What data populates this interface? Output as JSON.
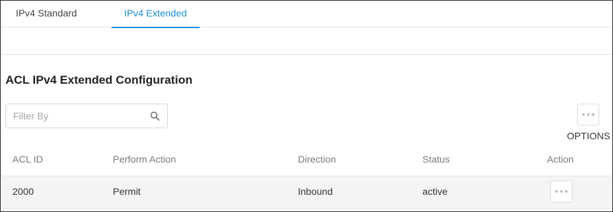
{
  "tabs": [
    {
      "label": "IPv4 Standard",
      "active": false
    },
    {
      "label": "IPv4 Extended",
      "active": true
    }
  ],
  "page_title": "ACL IPv4 Extended Configuration",
  "filter": {
    "placeholder": "Filter By",
    "value": "",
    "icon": "search-icon"
  },
  "options": {
    "label": "OPTIONS",
    "icon": "more-horizontal-icon"
  },
  "table": {
    "columns": [
      "ACL ID",
      "Perform Action",
      "Direction",
      "Status",
      "Action"
    ],
    "rows": [
      {
        "acl_id": "2000",
        "perform_action": "Permit",
        "direction": "Inbound",
        "status": "active",
        "action_icon": "more-horizontal-icon"
      }
    ]
  },
  "colors": {
    "accent": "#1a8fd8",
    "row_bg": "#f4f4f4",
    "border": "#e3e3e3"
  }
}
